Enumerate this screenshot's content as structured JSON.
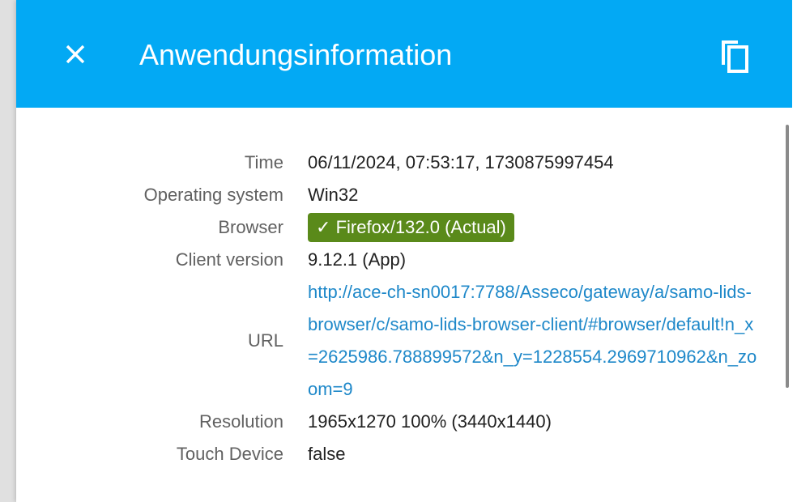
{
  "header": {
    "title": "Anwendungsinformation",
    "close_icon": "close-icon",
    "copy_icon": "copy-icon",
    "background_color": "#03a9f4"
  },
  "info": {
    "time_label": "Time",
    "time_value": "06/11/2024, 07:53:17, 1730875997454",
    "os_label": "Operating system",
    "os_value": "Win32",
    "browser_label": "Browser",
    "browser_check": "✓",
    "browser_value": "Firefox/132.0 (Actual)",
    "browser_badge_color": "#5a8a1a",
    "client_label": "Client version",
    "client_value": "9.12.1 (App)",
    "url_label": "URL",
    "url_value": "http://ace-ch-sn0017:7788/Asseco/gateway/a/samo-lids-browser/c/samo-lids-browser-client/#browser/default!n_x=2625986.788899572&n_y=1228554.2969710962&n_zoom=9",
    "url_color": "#1e88c9",
    "resolution_label": "Resolution",
    "resolution_value": "1965x1270 100% (3440x1440)",
    "touch_label": "Touch Device",
    "touch_value": "false"
  }
}
